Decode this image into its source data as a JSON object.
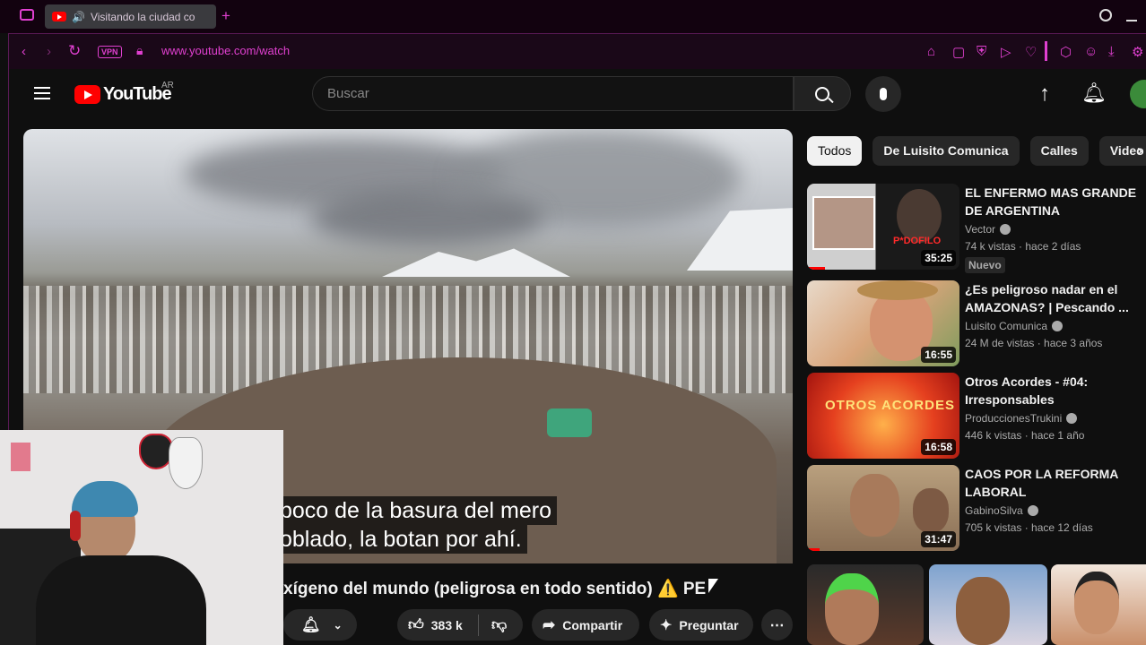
{
  "browser": {
    "tab_title": "Visitando la ciudad co",
    "url": "www.youtube.com/watch",
    "vpn_label": "VPN",
    "new_tab": "+"
  },
  "youtube": {
    "logo_text": "YouTube",
    "country_code": "AR",
    "search_placeholder": "Buscar"
  },
  "video": {
    "caption_line1": "poco de la basura del mero",
    "caption_line2": "oblado, la botan por ahí.",
    "title": "xígeno del mundo (peligrosa en todo sentido) ⚠️ PE",
    "like_count": "383 k",
    "share_label": "Compartir",
    "ask_label": "Preguntar"
  },
  "chips": [
    "Todos",
    "De Luisito Comunica",
    "Calles",
    "Video"
  ],
  "recommendations": [
    {
      "title": "EL ENFERMO MAS GRANDE DE ARGENTINA",
      "channel": "Vector",
      "meta": "74 k vistas · hace 2 días",
      "duration": "35:25",
      "badge": "Nuevo",
      "thumb_text": "P*DOFILO",
      "progress": 0.12
    },
    {
      "title": "¿Es peligroso nadar en el AMAZONAS? | Pescando ...",
      "channel": "Luisito Comunica",
      "meta": "24 M de vistas · hace 3 años",
      "duration": "16:55",
      "badge": "",
      "thumb_text": "",
      "progress": 0
    },
    {
      "title": "Otros Acordes - #04: Irresponsables",
      "channel": "ProduccionesTrukini",
      "meta": "446 k vistas · hace 1 año",
      "duration": "16:58",
      "badge": "",
      "thumb_text": "OTROS ACORDES",
      "progress": 0
    },
    {
      "title": "CAOS POR LA REFORMA LABORAL",
      "channel": "GabinoSilva",
      "meta": "705 k vistas · hace 12 días",
      "duration": "31:47",
      "badge": "",
      "thumb_text": "",
      "progress": 0.08
    }
  ],
  "colors": {
    "accent_magenta": "#e040d0",
    "yt_red": "#ff0000",
    "bg": "#0f0f0f"
  }
}
